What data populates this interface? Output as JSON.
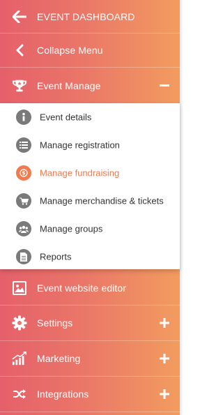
{
  "colors": {
    "gradient_start": "#e5606a",
    "gradient_end": "#f29c5f",
    "active_item": "#f07b4f",
    "sub_icon_bg": "#7a7a7a",
    "sub_text": "#333333"
  },
  "menu": {
    "dashboard": {
      "label": "EVENT DASHBOARD",
      "icon": "arrow-left-icon"
    },
    "collapse": {
      "label": "Collapse Menu",
      "icon": "chevron-left-icon"
    },
    "event_manage": {
      "label": "Event Manage",
      "icon": "trophy-icon",
      "toggle": "minus-icon",
      "expanded": true
    },
    "submenu": [
      {
        "label": "Event details",
        "icon": "info-icon",
        "active": false
      },
      {
        "label": "Manage registration",
        "icon": "list-icon",
        "active": false
      },
      {
        "label": "Manage fundraising",
        "icon": "dollar-icon",
        "active": true
      },
      {
        "label": "Manage merchandise & tickets",
        "icon": "cart-icon",
        "active": false
      },
      {
        "label": "Manage groups",
        "icon": "group-icon",
        "active": false
      },
      {
        "label": "Reports",
        "icon": "document-icon",
        "active": false
      }
    ],
    "website_editor": {
      "label": "Event website editor",
      "icon": "image-icon"
    },
    "settings": {
      "label": "Settings",
      "icon": "gear-icon",
      "toggle": "plus-icon"
    },
    "marketing": {
      "label": "Marketing",
      "icon": "bar-chart-icon",
      "toggle": "plus-icon"
    },
    "integrations": {
      "label": "Integrations",
      "icon": "shuffle-icon",
      "toggle": "plus-icon"
    }
  }
}
